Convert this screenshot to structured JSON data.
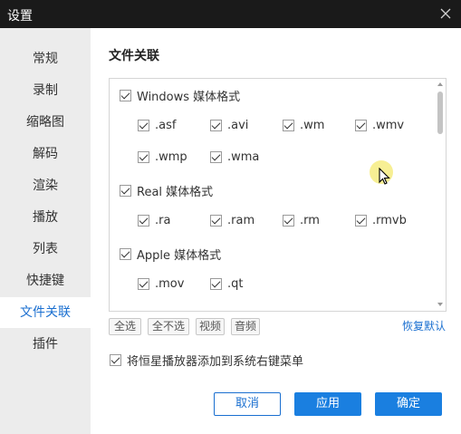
{
  "window": {
    "title": "设置"
  },
  "sidebar": {
    "items": [
      {
        "label": "常规"
      },
      {
        "label": "录制"
      },
      {
        "label": "缩略图"
      },
      {
        "label": "解码"
      },
      {
        "label": "渲染"
      },
      {
        "label": "播放"
      },
      {
        "label": "列表"
      },
      {
        "label": "快捷键"
      },
      {
        "label": "文件关联"
      },
      {
        "label": "插件"
      }
    ],
    "active": "文件关联"
  },
  "main": {
    "section_title": "文件关联",
    "groups": [
      {
        "label": "Windows 媒体格式",
        "checked": true,
        "items": [
          ".asf",
          ".avi",
          ".wm",
          ".wmv",
          ".wmp",
          ".wma"
        ]
      },
      {
        "label": "Real 媒体格式",
        "checked": true,
        "items": [
          ".ra",
          ".ram",
          ".rm",
          ".rmvb"
        ]
      },
      {
        "label": "Apple 媒体格式",
        "checked": true,
        "items": [
          ".mov",
          ".qt"
        ]
      }
    ],
    "buttons": {
      "select_all": "全选",
      "select_none": "全不选",
      "video": "视频",
      "audio": "音频",
      "restore_default": "恢复默认"
    },
    "context_menu_option": {
      "label": "将恒星播放器添加到系统右键菜单",
      "checked": true
    },
    "dialog_buttons": {
      "cancel": "取消",
      "apply": "应用",
      "ok": "确定"
    }
  },
  "colors": {
    "accent": "#1a6fd0",
    "primary_button": "#1a7fe0",
    "titlebar": "#1a1a1a",
    "sidebar_bg": "#ececec"
  }
}
